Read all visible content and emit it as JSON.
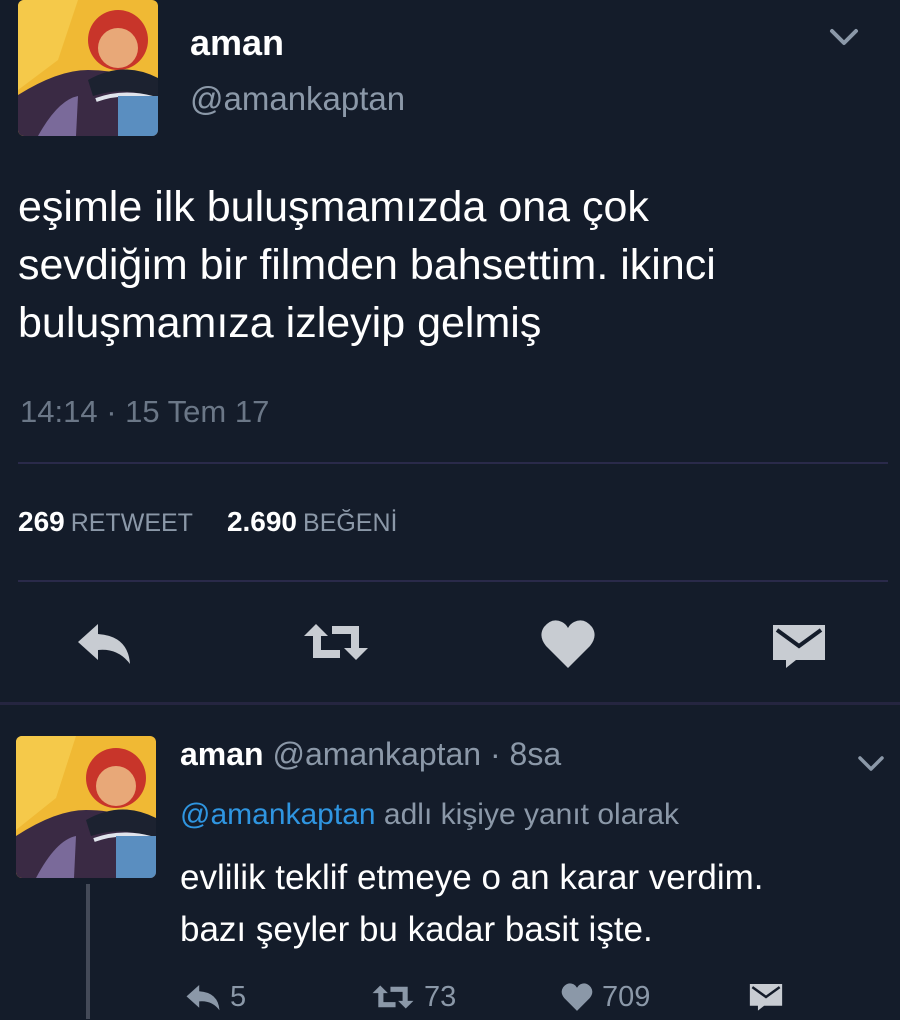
{
  "tweet": {
    "display_name": "aman",
    "handle": "@amankaptan",
    "text": "eşimle ilk buluşmamızda ona çok\nsevdiğim bir filmden bahsettim. ikinci\nbuluşmamıza izleyip gelmiş",
    "timestamp": "14:14 · 15 Tem 17",
    "retweet_count": "269",
    "retweet_label": "RETWEET",
    "like_count": "2.690",
    "like_label": "BEĞENİ",
    "icons": [
      "reply-icon",
      "retweet-icon",
      "like-icon",
      "direct-message-icon",
      "chevron-down-icon"
    ]
  },
  "reply": {
    "display_name": "aman",
    "meta": "@amankaptan · 8sa",
    "reply_to_mention": "@amankaptan",
    "reply_to_suffix": "adlı kişiye yanıt olarak",
    "text": "evlilik teklif etmeye o an karar verdim.\nbazı şeyler bu kadar basit işte.",
    "reply_count": "5",
    "retweet_count": "73",
    "like_count": "709"
  },
  "colors": {
    "background": "#141c2a",
    "text": "#ffffff",
    "muted": "#8b98a8",
    "mention": "#2f95e0",
    "icon": "#c8ccd2"
  }
}
